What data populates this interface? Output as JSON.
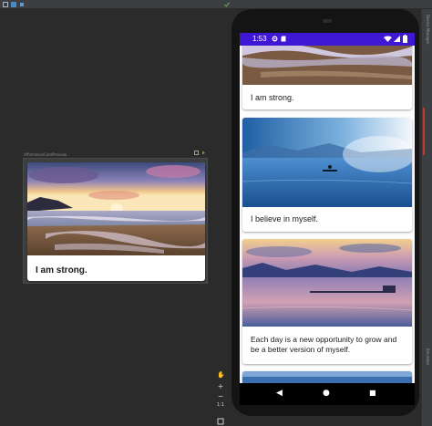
{
  "preview": {
    "label": "AffirmationCardPreview",
    "card": {
      "text": "I am strong."
    }
  },
  "device": {
    "status": {
      "time": "1:53"
    },
    "cards": [
      {
        "text": "I am strong."
      },
      {
        "text": "I believe in myself."
      },
      {
        "text": "Each day is a new opportunity to grow and be a better version of myself."
      }
    ],
    "nav": {
      "back": "◀",
      "home": "●",
      "recents": "■"
    }
  },
  "side_tabs": {
    "top": "Device Manager",
    "bottom": "Emulator"
  },
  "zoom": {
    "plus": "+",
    "minus": "−",
    "one_to_one": "1:1"
  },
  "colors": {
    "ide_bg": "#2b2b2b",
    "status_bar": "#3f18d6",
    "card_bg": "#ffffff"
  }
}
